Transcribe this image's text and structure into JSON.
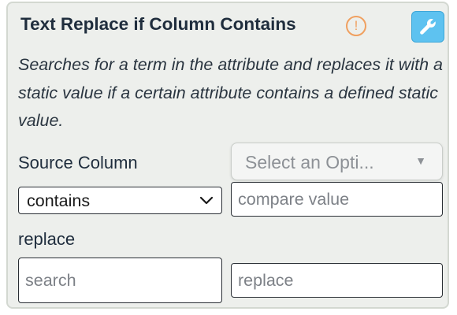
{
  "card": {
    "title": "Text Replace if Column Contains",
    "info_glyph": "!",
    "info_icon": "exclamation-circle-icon",
    "settings_icon": "wrench-icon",
    "accent_color": "#5ec2f0",
    "warning_color": "#f0a060",
    "description": "Searches for a term in the attribute and replaces it with a static value if a certain attribute contains a defined static value."
  },
  "source_column": {
    "label": "Source Column",
    "placeholder": "Select an Opti...",
    "caret": "▼"
  },
  "condition": {
    "selected": "contains",
    "compare_placeholder": "compare value"
  },
  "replace_section": {
    "label": "replace",
    "search_placeholder": "search",
    "replace_placeholder": "replace"
  }
}
